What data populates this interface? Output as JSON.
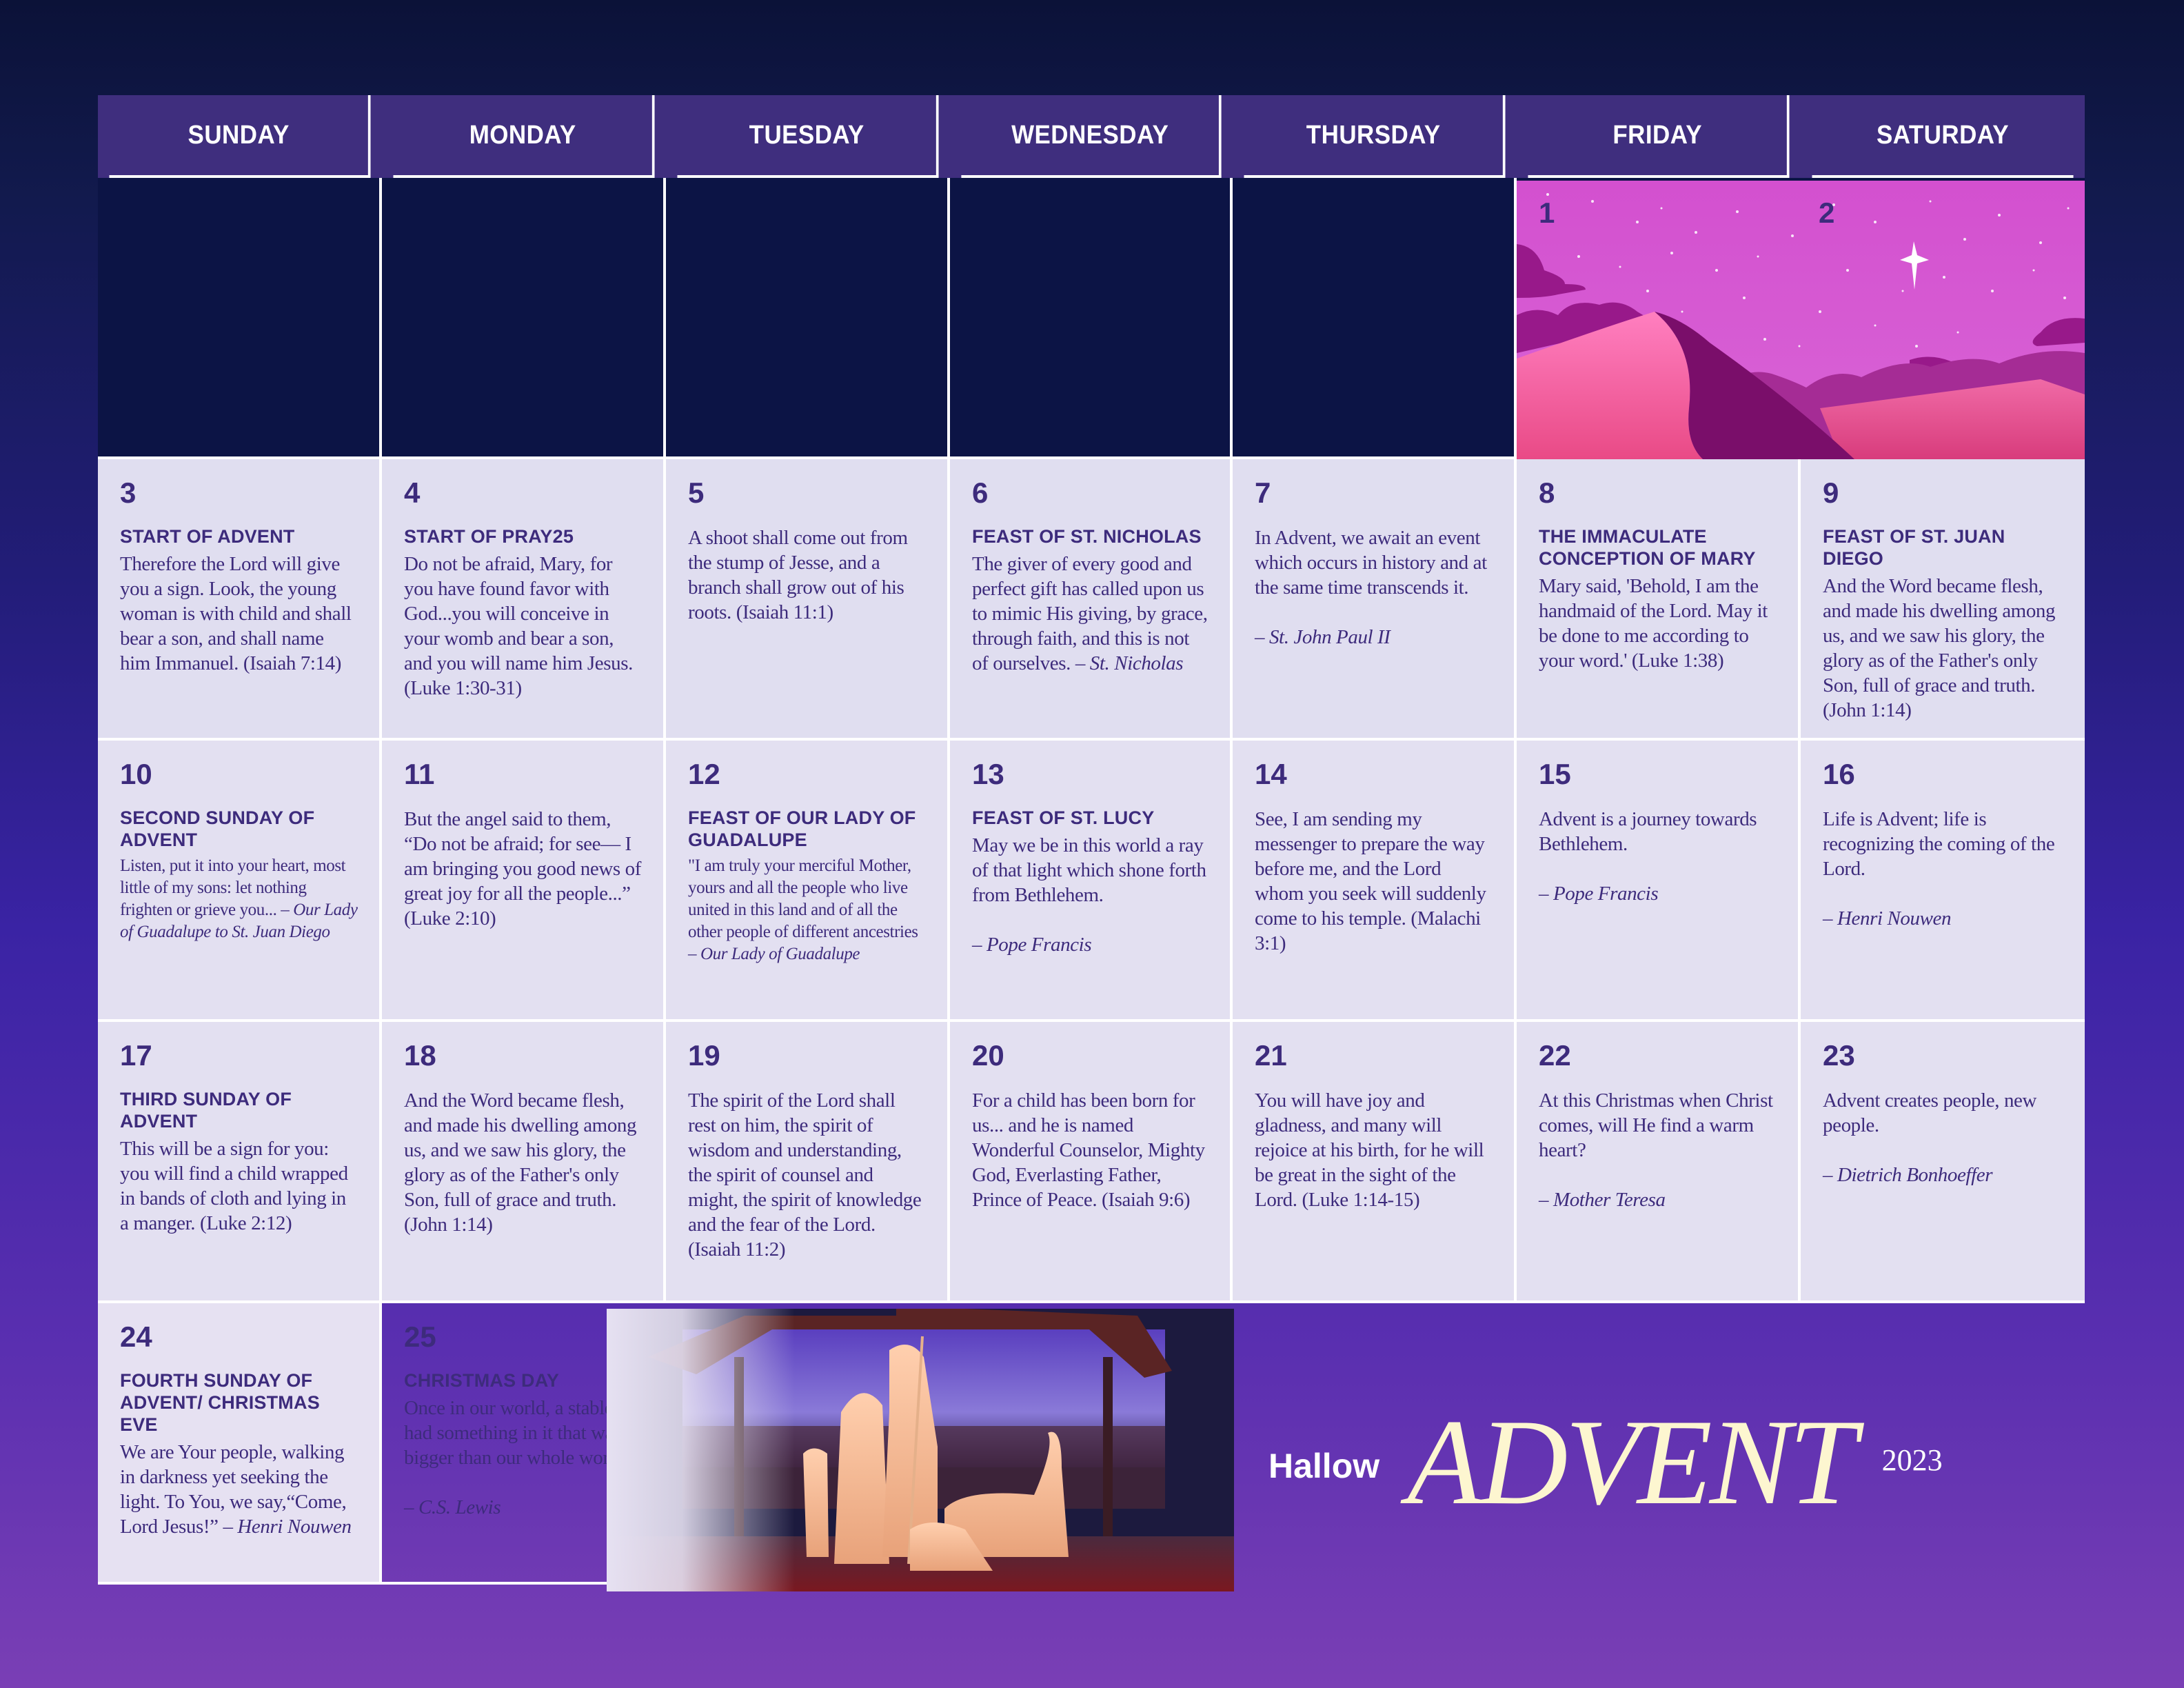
{
  "weekdays": [
    "SUNDAY",
    "MONDAY",
    "TUESDAY",
    "WEDNESDAY",
    "THURSDAY",
    "FRIDAY",
    "SATURDAY"
  ],
  "colors": {
    "header_bg": "#3f2e7e",
    "text_accent": "#3d2b7c",
    "cell_bg": "#e0def0",
    "empty_bg": "#0c1445",
    "brand_cream": "#fdf6d0"
  },
  "week1": [
    {
      "day": "1"
    },
    {
      "day": "2"
    }
  ],
  "week2": [
    {
      "day": "3",
      "title": "START OF ADVENT",
      "text": "Therefore the Lord will give you a sign. Look, the young woman is with child and shall bear a son, and shall name him Immanuel. (Isaiah 7:14)",
      "attrib": ""
    },
    {
      "day": "4",
      "title": "START OF PRAY25",
      "text": "Do not be afraid, Mary, for you have found favor with God...you will conceive in your womb and bear a son, and you will name him Jesus. (Luke 1:30-31)",
      "attrib": ""
    },
    {
      "day": "5",
      "title": "",
      "text": "A shoot shall come out from the stump of Jesse, and a branch shall grow out of his roots. (Isaiah 11:1)",
      "attrib": ""
    },
    {
      "day": "6",
      "title": "FEAST OF ST. NICHOLAS",
      "text": "The giver of every good and perfect gift has called upon us to mimic His giving, by grace, through faith, and this is not of ourselves.",
      "attrib": " – St. Nicholas"
    },
    {
      "day": "7",
      "title": "",
      "text": "In Advent, we await an event which occurs in history and at the same time transcends it.",
      "attrib": "– St. John Paul II"
    },
    {
      "day": "8",
      "title": "THE IMMACULATE CONCEPTION OF MARY",
      "text": "Mary said, 'Behold, I am the handmaid of the Lord. May it be done to me according to your word.' (Luke 1:38)",
      "attrib": ""
    },
    {
      "day": "9",
      "title": "FEAST OF ST. JUAN DIEGO",
      "text": "And the Word became flesh, and made his dwelling among us, and we saw his glory, the glory as of the Father's only Son, full of grace and truth. (John 1:14)",
      "attrib": ""
    }
  ],
  "week3": [
    {
      "day": "10",
      "title": "SECOND SUNDAY OF ADVENT",
      "text": "Listen, put it into your heart, most little of my sons: let nothing frighten or grieve you...",
      "attrib": " – Our Lady of Guadalupe to St. Juan Diego"
    },
    {
      "day": "11",
      "title": "",
      "text": "But the angel said to them, “Do not be afraid; for see— I am bringing you good news of great joy for all the people...” (Luke 2:10)",
      "attrib": ""
    },
    {
      "day": "12",
      "title": "FEAST OF OUR LADY OF GUADALUPE",
      "text": "\"I am truly your merciful Mother, yours and all the people who live united in this land and of all the other people of different ancestries",
      "attrib": " – Our Lady of Guadalupe"
    },
    {
      "day": "13",
      "title": "FEAST OF ST. LUCY",
      "text": "May we be in this world a ray of that light which shone forth from Bethlehem.",
      "attrib": "– Pope Francis"
    },
    {
      "day": "14",
      "title": "",
      "text": "See, I am sending my messenger to prepare the way before me, and the Lord whom you seek will suddenly come to his temple. (Malachi 3:1)",
      "attrib": ""
    },
    {
      "day": "15",
      "title": "",
      "text": "Advent is a journey towards Bethlehem.",
      "attrib": "– Pope Francis"
    },
    {
      "day": "16",
      "title": "",
      "text": "Life is Advent; life is recognizing the coming of the Lord.",
      "attrib": "– Henri Nouwen"
    }
  ],
  "week4": [
    {
      "day": "17",
      "title": "THIRD SUNDAY OF ADVENT",
      "text": "This will be a sign for you: you will find a child wrapped in bands of cloth and lying in a manger. (Luke 2:12)",
      "attrib": ""
    },
    {
      "day": "18",
      "title": "",
      "text": "And the Word became flesh, and made his dwelling among us, and we saw his glory, the glory as of the Father's only Son, full of grace and truth. (John 1:14)",
      "attrib": ""
    },
    {
      "day": "19",
      "title": "",
      "text": "The spirit of the Lord shall rest on him, the spirit of wisdom and understanding, the spirit of counsel and might, the spirit of knowledge and the fear of the Lord. (Isaiah 11:2)",
      "attrib": ""
    },
    {
      "day": "20",
      "title": "",
      "text": "For a child has been born for us... and he is named Wonderful Counselor, Mighty God, Everlasting Father, Prince of Peace. (Isaiah 9:6)",
      "attrib": ""
    },
    {
      "day": "21",
      "title": "",
      "text": "You will have joy and gladness, and many will rejoice at his birth, for he will be great in the sight of the Lord. (Luke 1:14-15)",
      "attrib": ""
    },
    {
      "day": "22",
      "title": "",
      "text": "At this Christmas when Christ comes, will He find a warm heart?",
      "attrib": "– Mother Teresa"
    },
    {
      "day": "23",
      "title": "",
      "text": "Advent creates people, new people.",
      "attrib": "– Dietrich Bonhoeffer"
    }
  ],
  "week5": [
    {
      "day": "24",
      "title": "FOURTH SUNDAY OF ADVENT/ CHRISTMAS EVE",
      "text": "We are Your people, walking in darkness yet seeking the light. To You, we say,“Come, Lord Jesus!”",
      "attrib": " – Henri Nouwen"
    },
    {
      "day": "25",
      "title": "CHRISTMAS DAY",
      "text": "Once in our world, a stable had something in it that was bigger than our whole world.",
      "attrib": "– C.S. Lewis"
    }
  ],
  "brand": {
    "hallow": "Hallow",
    "title": "ADVENT",
    "year": "2023"
  },
  "illustrations": {
    "desert": "desert-night-star-illustration",
    "nativity": "nativity-scene-illustration"
  }
}
